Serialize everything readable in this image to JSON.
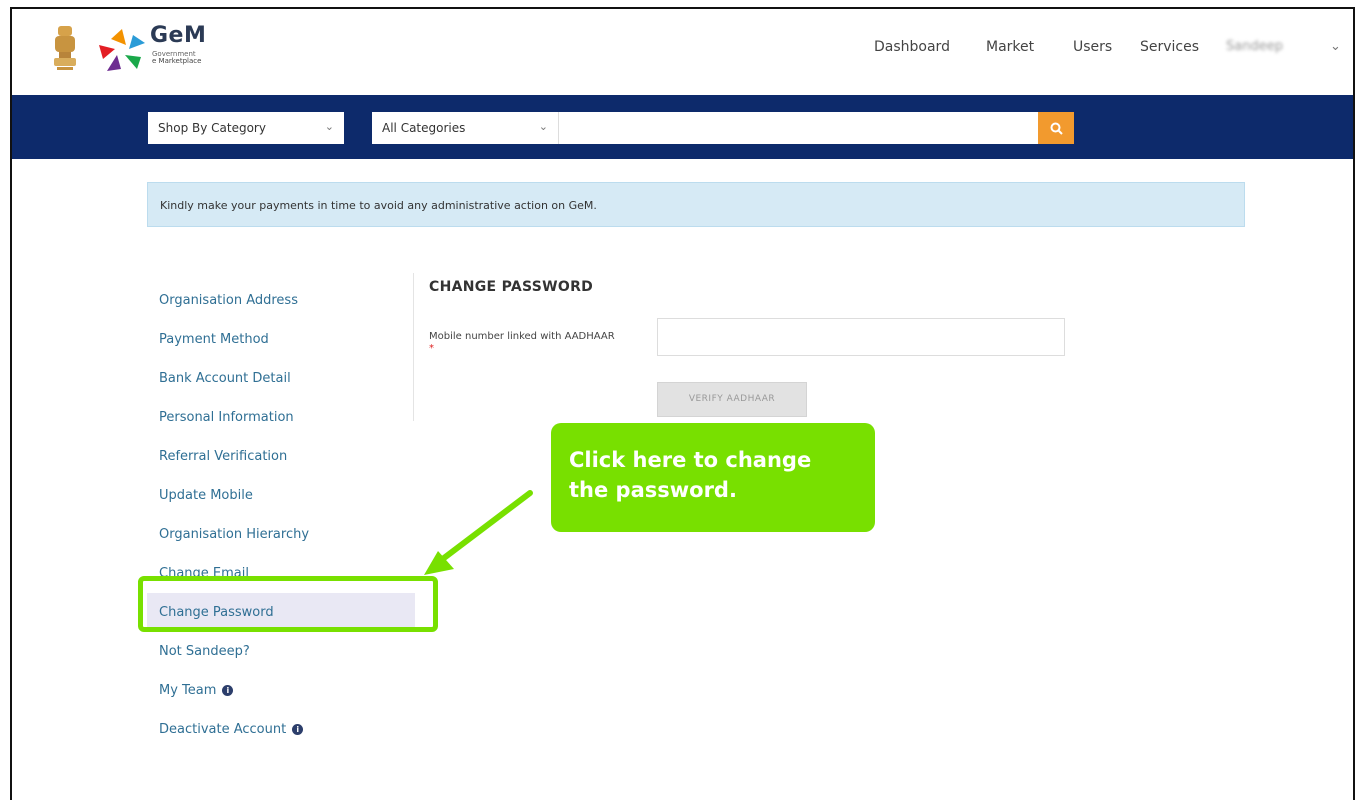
{
  "header": {
    "brand_title": "GeM",
    "brand_sub": "Government",
    "brand_sub2": "e Marketplace",
    "nav": [
      "Dashboard",
      "Market",
      "Users",
      "Services"
    ],
    "user_name": "Sandeep"
  },
  "search": {
    "shop_by": "Shop By Category",
    "categories": "All Categories",
    "placeholder": ""
  },
  "notice": "Kindly make your payments in time to avoid any administrative action on GeM.",
  "sidebar": {
    "items": [
      {
        "label": "Organisation Address"
      },
      {
        "label": "Payment Method"
      },
      {
        "label": "Bank Account Detail"
      },
      {
        "label": "Personal Information"
      },
      {
        "label": "Referral Verification"
      },
      {
        "label": "Update Mobile"
      },
      {
        "label": "Organisation Hierarchy"
      },
      {
        "label": "Change Email"
      },
      {
        "label": "Change Password"
      },
      {
        "label": "Not Sandeep?"
      },
      {
        "label": "My Team"
      },
      {
        "label": "Deactivate Account"
      }
    ]
  },
  "form": {
    "title": "CHANGE PASSWORD",
    "label": "Mobile number linked with AADHAAR",
    "required": "*",
    "value": "",
    "verify_button": "VERIFY AADHAAR"
  },
  "callout": {
    "text": "Click here to change the password."
  },
  "colors": {
    "accent_green": "#78e000",
    "band_blue": "#0d2a6b",
    "search_orange": "#f29a2e",
    "link_blue": "#2f6f94"
  }
}
